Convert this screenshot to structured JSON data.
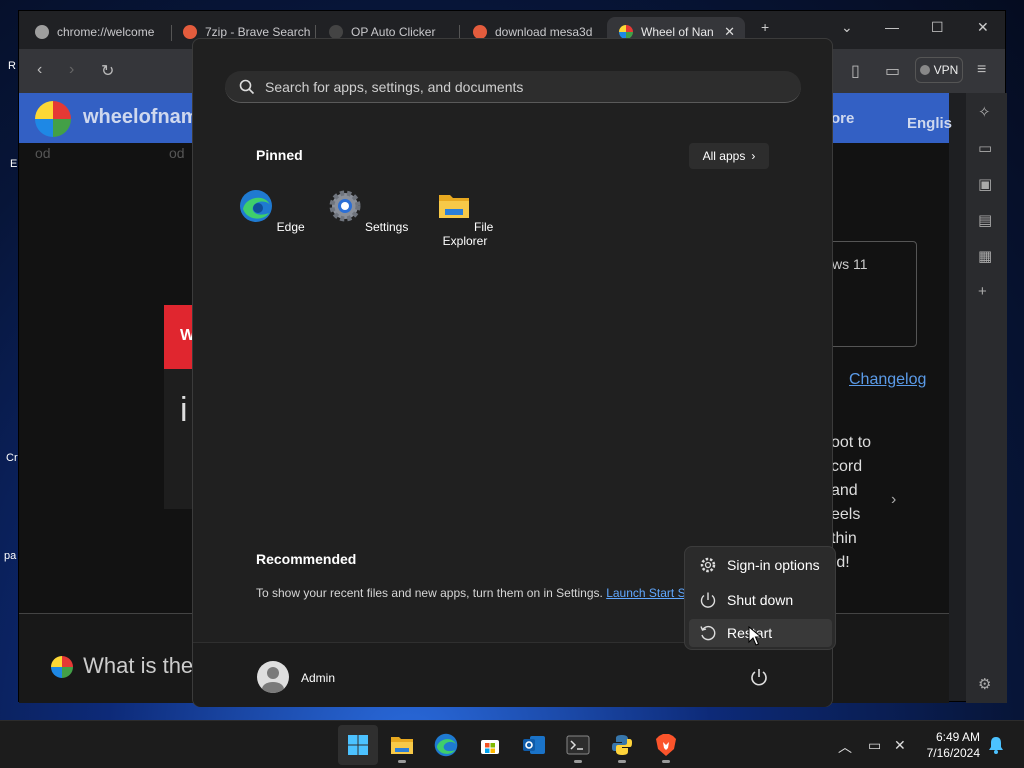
{
  "desktop": {
    "icon_labels": [
      "R",
      "E",
      "Cr",
      "pa"
    ]
  },
  "browser": {
    "tabs": [
      {
        "label": "chrome://welcome",
        "icon_color": "#9e9e9e"
      },
      {
        "label": "7zip - Brave Search",
        "icon_color": "#e35c3d"
      },
      {
        "label": "OP Auto Clicker",
        "icon_color": "#444444"
      },
      {
        "label": "download mesa3d",
        "icon_color": "#e35c3d"
      },
      {
        "label": "Wheel of Nan",
        "icon_color": "#e04040"
      }
    ],
    "new_tab_label": "+",
    "vpn_label": "VPN",
    "page": {
      "site_name": "wheelofnam",
      "more_label": "ore",
      "language_label": "Englis",
      "card_text": "ws 11",
      "changelog_label": "Changelog",
      "side_text_lines": [
        "oot to",
        "cord",
        "and",
        "eels",
        "thin",
        "rd!"
      ],
      "bottom_heading": "What is the",
      "left_fragment_1": "W",
      "left_fragment_2": "i",
      "faded_labels": [
        "od",
        "od"
      ]
    }
  },
  "start_menu": {
    "search_placeholder": "Search for apps, settings, and documents",
    "pinned_title": "Pinned",
    "all_apps_label": "All apps",
    "pinned_apps": [
      {
        "label": "Edge",
        "icon": "edge-icon"
      },
      {
        "label": "Settings",
        "icon": "settings-gear-icon"
      },
      {
        "label": "File Explorer",
        "icon": "folder-icon"
      }
    ],
    "recommended_title": "Recommended",
    "recommended_text": "To show your recent files and new apps, turn them on in Settings.",
    "recommended_link": "Launch Start S",
    "user_name": "Admin",
    "accent_color": "#60a8ff"
  },
  "power_menu": {
    "items": [
      {
        "label": "Sign-in options",
        "icon": "gear-icon"
      },
      {
        "label": "Shut down",
        "icon": "power-icon"
      },
      {
        "label": "Restart",
        "icon": "restart-icon"
      }
    ],
    "hovered": "Restart"
  },
  "taskbar": {
    "apps": [
      "start-icon",
      "file-explorer-icon",
      "edge-icon",
      "store-icon",
      "outlook-icon",
      "terminal-icon",
      "python-icon",
      "brave-icon"
    ],
    "time": "6:49 AM",
    "date": "7/16/2024"
  }
}
